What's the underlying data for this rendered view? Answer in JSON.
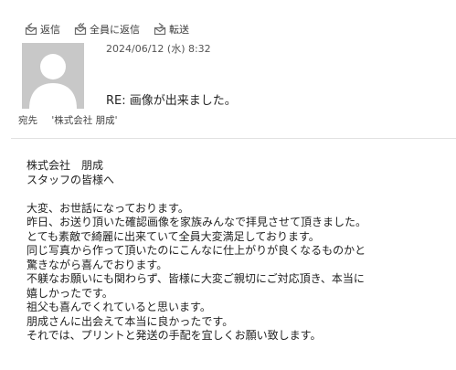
{
  "toolbar": {
    "reply_label": "返信",
    "reply_all_label": "全員に返信",
    "forward_label": "転送",
    "reply_icon": "reply-icon",
    "reply_all_icon": "reply-all-icon",
    "forward_icon": "forward-icon",
    "icon_color": "#6b6b6b"
  },
  "header": {
    "date": "2024/06/12 (水) 8:32",
    "subject": "RE: 画像が出来ました。",
    "to_label": "宛先",
    "to_value": "'株式会社 朋成'"
  },
  "avatar": {
    "bg_color": "#c8c8c8",
    "silhouette_color": "#ffffff"
  },
  "body": {
    "lines": [
      "株式会社　朋成",
      "スタッフの皆様へ",
      "",
      "大変、お世話になっております。",
      "昨日、お送り頂いた確認画像を家族みんなで拝見させて頂きました。",
      "とても素敵で綺麗に出来ていて全員大変満足しております。",
      "同じ写真から作って頂いたのにこんなに仕上がりが良くなるものかと",
      "驚きながら喜んでおります。",
      "不躾なお願いにも関わらず、皆様に大変ご親切にご対応頂き、本当に",
      "嬉しかったです。",
      "祖父も喜んでくれていると思います。",
      "朋成さんに出会えて本当に良かったです。",
      "それでは、プリントと発送の手配を宜しくお願い致します。"
    ]
  }
}
